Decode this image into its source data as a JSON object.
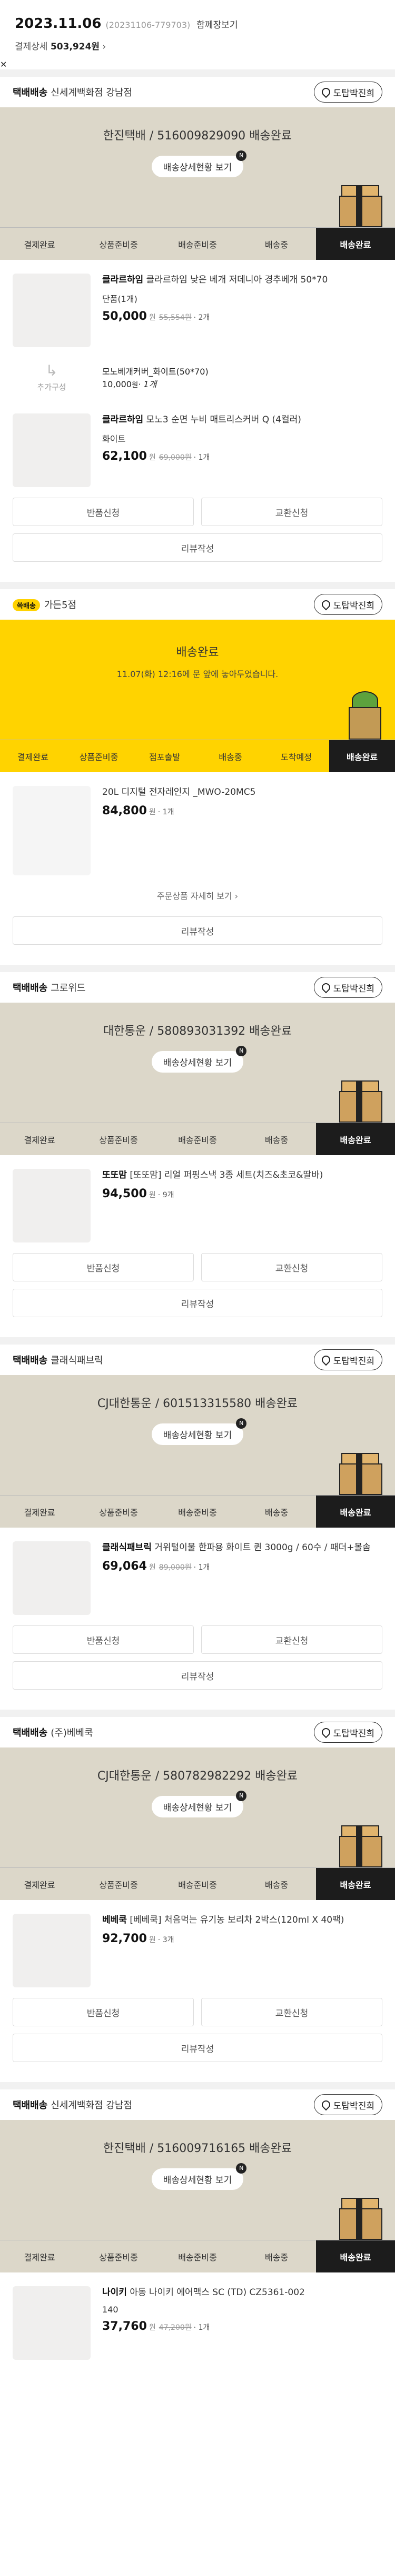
{
  "header": {
    "date": "2023.11.06",
    "order_id": "(20231106-779703)",
    "together": "함께장보기",
    "total_label": "결제상세",
    "total": "503,924원",
    "close": "✕"
  },
  "map_label": "도탑박진희",
  "groups": [
    {
      "seller_type": "택배배송",
      "seller": "신세계백화점 강남점",
      "status": "한진택배 / 516009829090 배송완료",
      "track": "배송상세현황 보기",
      "steps": [
        "결제완료",
        "상품준비중",
        "배송준비중",
        "배송중",
        "배송완료"
      ],
      "items": [
        {
          "brand": "클라르하임",
          "name": "클라르하임 낮은 베개 저데니아 경추베개 50*70",
          "opt": "단품(1개)",
          "price": "50,000",
          "unit": "원",
          "orig": "55,554원",
          "qty": "· 2개"
        },
        {
          "brand": "",
          "name": "모노베개커버_화이트(50*70)",
          "opt": "",
          "price": "10,000",
          "unit": "원",
          "orig": "",
          "qty": "· 1개",
          "addon": "추가구성"
        },
        {
          "brand": "클라르하임",
          "name": "모노3 순면 누비 매트리스커버 Q (4컬러)",
          "opt": "화이트",
          "price": "62,100",
          "unit": "원",
          "orig": "69,000원",
          "qty": "· 1개"
        }
      ],
      "acts": [
        "반품신청",
        "교환신청",
        "리뷰작성"
      ]
    },
    {
      "seller_type": "",
      "badge": "쓱배송",
      "seller": "가든5점",
      "yellow": true,
      "status": "배송완료",
      "sub": "11.07(화) 12:16에 문 앞에 놓아두었습니다.",
      "steps": [
        "결제완료",
        "상품준비중",
        "점포출발",
        "배송중",
        "도착예정",
        "배송완료"
      ],
      "items": [
        {
          "name": "20L 디지털 전자레인지 _MWO-20MC5",
          "price": "84,800",
          "unit": "원",
          "qty": "· 1개",
          "small": true
        }
      ],
      "detail": "주문상품 자세히 보기 ›",
      "acts": [
        "리뷰작성"
      ]
    },
    {
      "seller_type": "택배배송",
      "seller": "그로위드",
      "status": "대한통운 / 580893031392 배송완료",
      "track": "배송상세현황 보기",
      "steps": [
        "결제완료",
        "상품준비중",
        "배송준비중",
        "배송중",
        "배송완료"
      ],
      "items": [
        {
          "brand": "또또맘",
          "name": "[또또맘] 리얼 퍼핑스낵 3종 세트(치즈&초코&딸바)",
          "price": "94,500",
          "unit": "원",
          "qty": "· 9개"
        }
      ],
      "acts": [
        "반품신청",
        "교환신청",
        "리뷰작성"
      ]
    },
    {
      "seller_type": "택배배송",
      "seller": "클래식패브릭",
      "status": "CJ대한통운 / 601513315580 배송완료",
      "track": "배송상세현황 보기",
      "steps": [
        "결제완료",
        "상품준비중",
        "배송준비중",
        "배송중",
        "배송완료"
      ],
      "items": [
        {
          "brand": "클래식패브릭",
          "name": "거위털이불 한파용 화이트 퀸 3000g / 60수 / 패더+볼솜",
          "price": "69,064",
          "unit": "원",
          "orig": "89,000원",
          "qty": "· 1개"
        }
      ],
      "acts": [
        "반품신청",
        "교환신청",
        "리뷰작성"
      ]
    },
    {
      "seller_type": "택배배송",
      "seller": "(주)베베쿡",
      "status": "CJ대한통운 / 580782982292 배송완료",
      "track": "배송상세현황 보기",
      "steps": [
        "결제완료",
        "상품준비중",
        "배송준비중",
        "배송중",
        "배송완료"
      ],
      "items": [
        {
          "brand": "베베쿡",
          "name": "[베베쿡] 처음먹는 유기농 보리차 2박스(120ml X 40팩)",
          "price": "92,700",
          "unit": "원",
          "qty": "· 3개"
        }
      ],
      "acts": [
        "반품신청",
        "교환신청",
        "리뷰작성"
      ]
    },
    {
      "seller_type": "택배배송",
      "seller": "신세계백화점 강남점",
      "status": "한진택배 / 516009716165 배송완료",
      "track": "배송상세현황 보기",
      "steps": [
        "결제완료",
        "상품준비중",
        "배송준비중",
        "배송중",
        "배송완료"
      ],
      "items": [
        {
          "brand": "나이키",
          "name": "아동 나이키 에어맥스 SC (TD) CZ5361-002",
          "opt": "140",
          "price": "37,760",
          "unit": "원",
          "orig": "47,200원",
          "qty": "· 1개"
        }
      ],
      "acts": []
    }
  ]
}
